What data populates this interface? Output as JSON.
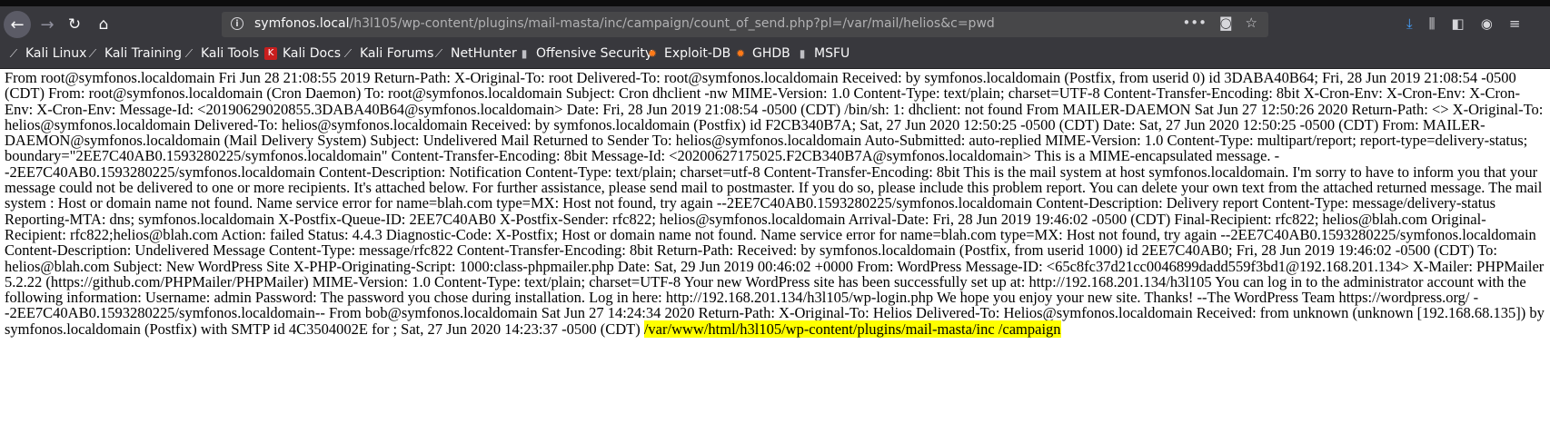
{
  "browser": {
    "url_host": "symfonos.local",
    "url_path": "/h3l105/wp-content/plugins/mail-masta/inc/campaign/count_of_send.php?pl=/var/mail/helios&c=pwd"
  },
  "bookmarks": [
    {
      "label": "Kali Linux",
      "icon": "kali-dragon-icon"
    },
    {
      "label": "Kali Training",
      "icon": "kali-dragon-icon"
    },
    {
      "label": "Kali Tools",
      "icon": "kali-dragon-icon"
    },
    {
      "label": "Kali Docs",
      "icon": "kali-docs-icon"
    },
    {
      "label": "Kali Forums",
      "icon": "kali-dragon-icon"
    },
    {
      "label": "NetHunter",
      "icon": "kali-dragon-icon"
    },
    {
      "label": "Offensive Security",
      "icon": "offsec-icon"
    },
    {
      "label": "Exploit-DB",
      "icon": "exploitdb-icon"
    },
    {
      "label": "GHDB",
      "icon": "exploitdb-icon"
    },
    {
      "label": "MSFU",
      "icon": "offsec-icon"
    }
  ],
  "page": {
    "body_text": "From root@symfonos.localdomain Fri Jun 28 21:08:55 2019 Return-Path: X-Original-To: root Delivered-To: root@symfonos.localdomain Received: by symfonos.localdomain (Postfix, from userid 0) id 3DABA40B64; Fri, 28 Jun 2019 21:08:54 -0500 (CDT) From: root@symfonos.localdomain (Cron Daemon) To: root@symfonos.localdomain Subject: Cron dhclient -nw MIME-Version: 1.0 Content-Type: text/plain; charset=UTF-8 Content-Transfer-Encoding: 8bit X-Cron-Env: X-Cron-Env: X-Cron-Env: X-Cron-Env: Message-Id: <20190629020855.3DABA40B64@symfonos.localdomain> Date: Fri, 28 Jun 2019 21:08:54 -0500 (CDT) /bin/sh: 1: dhclient: not found From MAILER-DAEMON Sat Jun 27 12:50:26 2020 Return-Path: <> X-Original-To: helios@symfonos.localdomain Delivered-To: helios@symfonos.localdomain Received: by symfonos.localdomain (Postfix) id F2CB340B7A; Sat, 27 Jun 2020 12:50:25 -0500 (CDT) Date: Sat, 27 Jun 2020 12:50:25 -0500 (CDT) From: MAILER-DAEMON@symfonos.localdomain (Mail Delivery System) Subject: Undelivered Mail Returned to Sender To: helios@symfonos.localdomain Auto-Submitted: auto-replied MIME-Version: 1.0 Content-Type: multipart/report; report-type=delivery-status; boundary=\"2EE7C40AB0.1593280225/symfonos.localdomain\" Content-Transfer-Encoding: 8bit Message-Id: <20200627175025.F2CB340B7A@symfonos.localdomain> This is a MIME-encapsulated message. --2EE7C40AB0.1593280225/symfonos.localdomain Content-Description: Notification Content-Type: text/plain; charset=utf-8 Content-Transfer-Encoding: 8bit This is the mail system at host symfonos.localdomain. I'm sorry to have to inform you that your message could not be delivered to one or more recipients. It's attached below. For further assistance, please send mail to postmaster. If you do so, please include this problem report. You can delete your own text from the attached returned message. The mail system : Host or domain name not found. Name service error for name=blah.com type=MX: Host not found, try again --2EE7C40AB0.1593280225/symfonos.localdomain Content-Description: Delivery report Content-Type: message/delivery-status Reporting-MTA: dns; symfonos.localdomain X-Postfix-Queue-ID: 2EE7C40AB0 X-Postfix-Sender: rfc822; helios@symfonos.localdomain Arrival-Date: Fri, 28 Jun 2019 19:46:02 -0500 (CDT) Final-Recipient: rfc822; helios@blah.com Original-Recipient: rfc822;helios@blah.com Action: failed Status: 4.4.3 Diagnostic-Code: X-Postfix; Host or domain name not found. Name service error for name=blah.com type=MX: Host not found, try again --2EE7C40AB0.1593280225/symfonos.localdomain Content-Description: Undelivered Message Content-Type: message/rfc822 Content-Transfer-Encoding: 8bit Return-Path: Received: by symfonos.localdomain (Postfix, from userid 1000) id 2EE7C40AB0; Fri, 28 Jun 2019 19:46:02 -0500 (CDT) To: helios@blah.com Subject: New WordPress Site X-PHP-Originating-Script: 1000:class-phpmailer.php Date: Sat, 29 Jun 2019 00:46:02 +0000 From: WordPress Message-ID: <65c8fc37d21cc0046899dadd559f3bd1@192.168.201.134> X-Mailer: PHPMailer 5.2.22 (https://github.com/PHPMailer/PHPMailer) MIME-Version: 1.0 Content-Type: text/plain; charset=UTF-8 Your new WordPress site has been successfully set up at: http://192.168.201.134/h3l105 You can log in to the administrator account with the following information: Username: admin Password: The password you chose during installation. Log in here: http://192.168.201.134/h3l105/wp-login.php We hope you enjoy your new site. Thanks! --The WordPress Team https://wordpress.org/ --2EE7C40AB0.1593280225/symfonos.localdomain-- From bob@symfonos.localdomain Sat Jun 27 14:24:34 2020 Return-Path: X-Original-To: Helios Delivered-To: Helios@symfonos.localdomain Received: from unknown (unknown [192.168.68.135]) by symfonos.localdomain (Postfix) with SMTP id 4C3504002E for ; Sat, 27 Jun 2020 14:23:37 -0500 (CDT) ",
    "highlighted_text": "/var/www/html/h3l105/wp-content/plugins/mail-masta/inc /campaign"
  }
}
